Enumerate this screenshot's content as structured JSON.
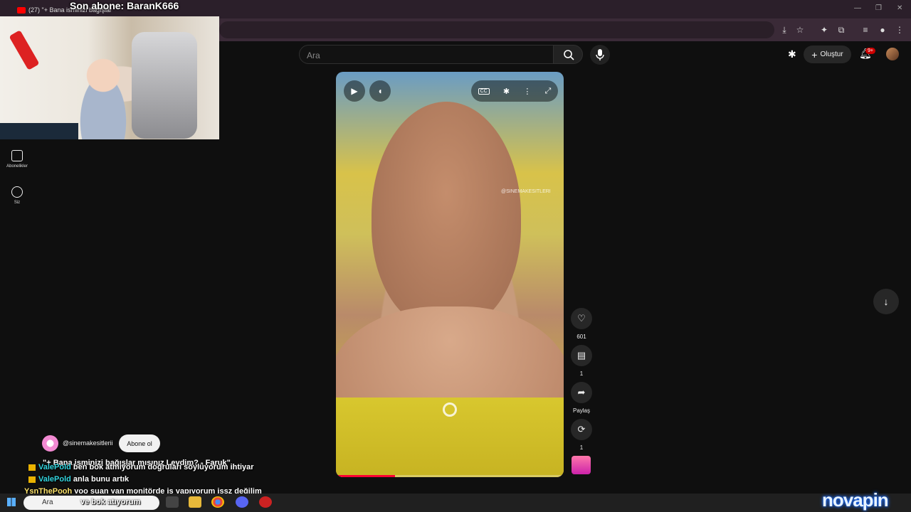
{
  "overlay": {
    "last_subscriber": "Son abone: BaranK666"
  },
  "browser": {
    "tab_title": "(27) \"+ Bana isminizi bağışlar"
  },
  "header": {
    "search_placeholder": "Ara",
    "create_label": "Oluştur",
    "notification_count": "9+"
  },
  "left_nav": [
    {
      "label": "Abonelikler",
      "icon": "subscriptions-icon"
    },
    {
      "label": "Siz",
      "icon": "account-icon"
    }
  ],
  "player": {
    "watermark": "@SINEMAKESITLERI",
    "progress_fraction": 0.26
  },
  "actions": {
    "likes": "601",
    "comments": "1",
    "share_label": "Paylaş",
    "remix": "1"
  },
  "channel": {
    "handle": "@sinemakesitlerii",
    "subscribe_label": "Abone ol"
  },
  "video_caption": "\"+ Bana isminizi bağışlar mısınız Levdim? - Faruk\"",
  "chat": [
    {
      "user": "ValePold",
      "message": "ben bok atmıyorum doğruları söylüyorum ihtiyar",
      "badge": true,
      "name_color": "cyan"
    },
    {
      "user": "ValePold",
      "message": "anla bunu artık",
      "badge": true,
      "name_color": "cyan"
    },
    {
      "user": "YsnThePooh",
      "message": "yoo şuan yan monitörde iş yapıyorum işsz değilim",
      "badge": false,
      "name_color": "yellow"
    },
    {
      "user": "",
      "message": "ve bok atıyorum",
      "badge": false,
      "name_color": "cyan"
    }
  ],
  "taskbar": {
    "search_placeholder": "Ara",
    "watermark_logo": "novapin"
  }
}
